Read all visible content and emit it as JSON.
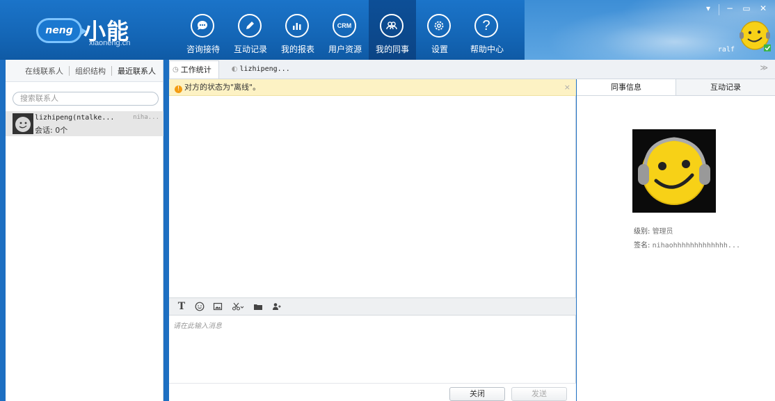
{
  "app": {
    "logo_badge": "neng",
    "logo_cn": "小能",
    "logo_domain": "xiaoneng.cn"
  },
  "nav": [
    {
      "label": "咨询接待",
      "icon": "chat-bubble-icon"
    },
    {
      "label": "互动记录",
      "icon": "pencil-icon"
    },
    {
      "label": "我的报表",
      "icon": "bar-chart-icon"
    },
    {
      "label": "用户资源",
      "icon": "crm-icon",
      "icon_text": "CRM"
    },
    {
      "label": "我的同事",
      "icon": "colleagues-icon",
      "active": true
    },
    {
      "label": "设置",
      "icon": "gear-icon"
    },
    {
      "label": "帮助中心",
      "icon": "help-icon",
      "icon_text": "?"
    }
  ],
  "window_controls": [
    "menu-arrow",
    "minimize",
    "restore",
    "close"
  ],
  "user": {
    "name": "ralf"
  },
  "left_panel": {
    "tabs": [
      "在线联系人",
      "组织结构",
      "最近联系人"
    ],
    "active_tab": 2,
    "search_placeholder": "搜索联系人",
    "contacts": [
      {
        "name": "lizhipeng(ntalke...",
        "signature": "niha...",
        "session": "会话: 0个"
      }
    ]
  },
  "center": {
    "tabs": [
      {
        "label": "工作统计",
        "icon": "clock-icon"
      },
      {
        "label": "lizhipeng...",
        "icon": "user-status-icon"
      }
    ],
    "active_tab": 0,
    "collapse_glyph": "≫",
    "notice": "对方的状态为\"离线\"。",
    "notice_close": "×",
    "toolbar": [
      "font-icon",
      "emoji-icon",
      "image-icon",
      "screenshot-icon",
      "folder-icon",
      "transfer-icon"
    ],
    "input_placeholder": "请在此输入消息",
    "close_label": "关闭",
    "send_label": "发送"
  },
  "right_panel": {
    "tabs": [
      "同事信息",
      "互动记录"
    ],
    "active_tab": 0,
    "level_label": "级别: ",
    "level_value": "管理员",
    "signature_label": "签名: ",
    "signature_value": "nihaohhhhhhhhhhhhh..."
  },
  "colors": {
    "brand_blue": "#1d6fc2",
    "nav_active": "#0d4f97",
    "notice_bg": "#fdf2c4",
    "smiley_yellow": "#f7d117"
  }
}
